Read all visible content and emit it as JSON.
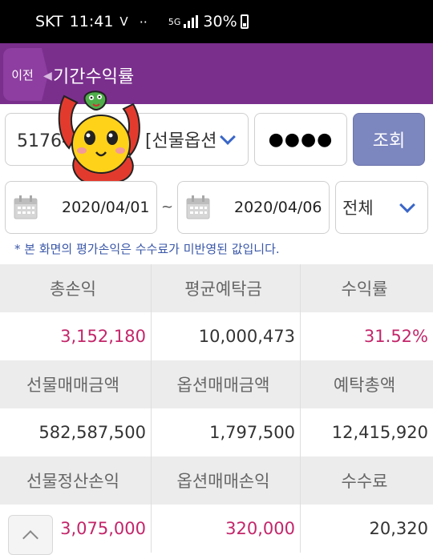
{
  "status_bar": {
    "carrier": "SKT",
    "time": "11:41",
    "indicator": "V",
    "network": "5G",
    "battery": "30%"
  },
  "header": {
    "back_label": "이전",
    "title": "기간수익률"
  },
  "query": {
    "account": "5176-",
    "account_suffix": "[선물옵션]",
    "password_mask": "●●●●",
    "search_label": "조회",
    "start_date": "2020/04/01",
    "date_separator": "~",
    "end_date": "2020/04/06",
    "type_selected": "전체"
  },
  "notice": "* 본 화면의 평가손익은 수수료가 미반영된 값입니다.",
  "summary": {
    "rows": [
      {
        "headers": [
          "총손익",
          "평균예탁금",
          "수익률"
        ],
        "values": [
          "3,152,180",
          "10,000,473",
          "31.52%"
        ]
      },
      {
        "headers": [
          "선물매매금액",
          "옵션매매금액",
          "예탁총액"
        ],
        "values": [
          "582,587,500",
          "1,797,500",
          "12,415,920"
        ]
      },
      {
        "headers": [
          "선물정산손익",
          "옵션매매손익",
          "수수료"
        ],
        "values": [
          "3,075,000",
          "320,000",
          "20,320"
        ]
      }
    ]
  },
  "colors": {
    "header_bg": "#7a2f8d",
    "search_button": "#7c86bf",
    "profit": "#c3266a",
    "notice": "#3a57a8"
  },
  "icons": [
    "calendar-icon",
    "chevron-down-icon",
    "chevron-up-icon",
    "back-arrow-icon"
  ]
}
